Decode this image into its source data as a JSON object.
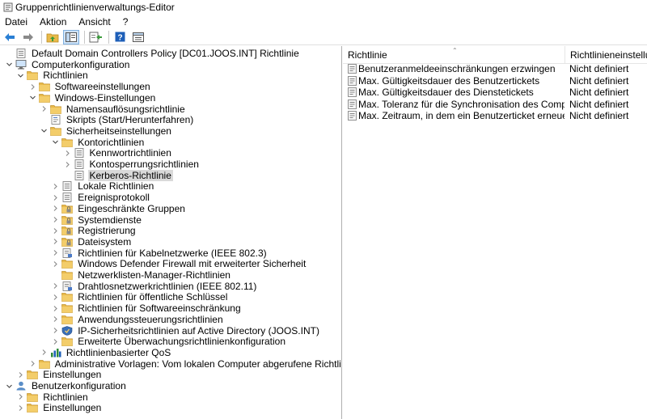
{
  "window": {
    "title": "Gruppenrichtlinienverwaltungs-Editor"
  },
  "menu": {
    "items": [
      "Datei",
      "Aktion",
      "Ansicht",
      "?"
    ]
  },
  "toolbar": {
    "icons": [
      "back-arrow-icon",
      "forward-arrow-icon",
      "up-folder-icon",
      "show-tree-icon",
      "export-list-icon",
      "help-icon",
      "properties-icon"
    ]
  },
  "tree": [
    {
      "label": "Default Domain Controllers Policy [DC01.JOOS.INT] Richtlinie",
      "icon": "policy",
      "chev": "none",
      "level": 0
    },
    {
      "label": "Computerkonfiguration",
      "icon": "computer",
      "chev": "open",
      "level": 0
    },
    {
      "label": "Richtlinien",
      "icon": "folder",
      "chev": "open",
      "level": 1
    },
    {
      "label": "Softwareeinstellungen",
      "icon": "folder",
      "chev": "closed",
      "level": 2
    },
    {
      "label": "Windows-Einstellungen",
      "icon": "folder",
      "chev": "open",
      "level": 2
    },
    {
      "label": "Namensauflösungsrichtlinie",
      "icon": "folder",
      "chev": "closed",
      "level": 3
    },
    {
      "label": "Skripts (Start/Herunterfahren)",
      "icon": "script",
      "chev": "none",
      "level": 3
    },
    {
      "label": "Sicherheitseinstellungen",
      "icon": "folder",
      "chev": "open",
      "level": 3
    },
    {
      "label": "Kontorichtlinien",
      "icon": "folder",
      "chev": "open",
      "level": 4
    },
    {
      "label": "Kennwortrichtlinien",
      "icon": "policy",
      "chev": "closed",
      "level": 5
    },
    {
      "label": "Kontosperrungsrichtlinien",
      "icon": "policy",
      "chev": "closed",
      "level": 5
    },
    {
      "label": "Kerberos-Richtlinie",
      "icon": "policy",
      "chev": "none",
      "level": 5,
      "selected": true
    },
    {
      "label": "Lokale Richtlinien",
      "icon": "policy",
      "chev": "closed",
      "level": 4
    },
    {
      "label": "Ereignisprotokoll",
      "icon": "policy",
      "chev": "closed",
      "level": 4
    },
    {
      "label": "Eingeschränkte Gruppen",
      "icon": "locked",
      "chev": "closed",
      "level": 4
    },
    {
      "label": "Systemdienste",
      "icon": "locked",
      "chev": "closed",
      "level": 4
    },
    {
      "label": "Registrierung",
      "icon": "locked",
      "chev": "closed",
      "level": 4
    },
    {
      "label": "Dateisystem",
      "icon": "locked",
      "chev": "closed",
      "level": 4
    },
    {
      "label": "Richtlinien für Kabelnetzwerke (IEEE 802.3)",
      "icon": "network",
      "chev": "closed",
      "level": 4
    },
    {
      "label": "Windows Defender Firewall mit erweiterter Sicherheit",
      "icon": "folder",
      "chev": "closed",
      "level": 4
    },
    {
      "label": "Netzwerklisten-Manager-Richtlinien",
      "icon": "folder",
      "chev": "none",
      "level": 4
    },
    {
      "label": "Drahtlosnetzwerkrichtlinien (IEEE 802.11)",
      "icon": "network",
      "chev": "closed",
      "level": 4
    },
    {
      "label": "Richtlinien für öffentliche Schlüssel",
      "icon": "folder",
      "chev": "closed",
      "level": 4
    },
    {
      "label": "Richtlinien für Softwareeinschränkung",
      "icon": "folder",
      "chev": "closed",
      "level": 4
    },
    {
      "label": "Anwendungssteuerungsrichtlinien",
      "icon": "folder",
      "chev": "closed",
      "level": 4
    },
    {
      "label": "IP-Sicherheitsrichtlinien auf Active Directory (JOOS.INT)",
      "icon": "ipsec",
      "chev": "closed",
      "level": 4
    },
    {
      "label": "Erweiterte Überwachungsrichtlinienkonfiguration",
      "icon": "folder",
      "chev": "closed",
      "level": 4
    },
    {
      "label": "Richtlinienbasierter QoS",
      "icon": "qos",
      "chev": "closed",
      "level": 3
    },
    {
      "label": "Administrative Vorlagen: Vom lokalen Computer abgerufene Richtliniendefinitionen (ADM",
      "icon": "folder",
      "chev": "closed",
      "level": 2
    },
    {
      "label": "Einstellungen",
      "icon": "folder",
      "chev": "closed",
      "level": 1
    },
    {
      "label": "Benutzerkonfiguration",
      "icon": "user",
      "chev": "open",
      "level": 0
    },
    {
      "label": "Richtlinien",
      "icon": "folder",
      "chev": "closed",
      "level": 1
    },
    {
      "label": "Einstellungen",
      "icon": "folder",
      "chev": "closed",
      "level": 1
    }
  ],
  "list": {
    "columns": [
      "Richtlinie",
      "Richtlinieneinstellung"
    ],
    "rows": [
      {
        "name": "Benutzeranmeldeeinschränkungen erzwingen",
        "value": "Nicht definiert"
      },
      {
        "name": "Max. Gültigkeitsdauer des Benutzertickets",
        "value": "Nicht definiert"
      },
      {
        "name": "Max. Gültigkeitsdauer des Dienstetickets",
        "value": "Nicht definiert"
      },
      {
        "name": "Max. Toleranz für die Synchronisation des Computertakts",
        "value": "Nicht definiert"
      },
      {
        "name": "Max. Zeitraum, in dem ein Benutzerticket erneuert werden kann",
        "value": "Nicht definiert"
      }
    ]
  },
  "colors": {
    "folder": "#e8b94a",
    "back_arrow": "#2a7fd4",
    "selection": "#d9d9d9"
  }
}
